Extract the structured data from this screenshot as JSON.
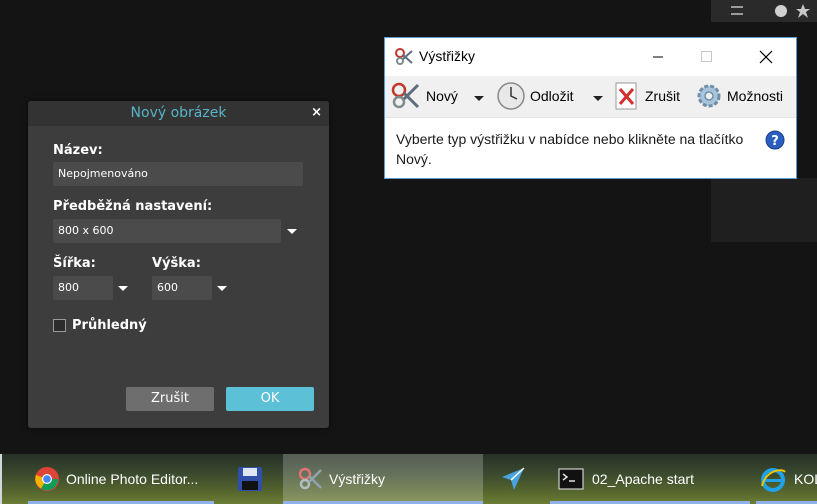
{
  "dialog": {
    "title": "Nový obrázek",
    "close_glyph": "×",
    "name_label": "Název:",
    "name_value": "Nepojmenováno",
    "preset_label": "Předběžná nastavení:",
    "preset_value": "800 x 600",
    "width_label": "Šířka:",
    "width_value": "800",
    "height_label": "Výška:",
    "height_value": "600",
    "transparent_label": "Průhledný",
    "transparent_checked": false,
    "cancel_label": "Zrušit",
    "ok_label": "OK"
  },
  "snip": {
    "title": "Výstřižky",
    "app_icon": "scissors-icon",
    "toolbar": [
      {
        "label": "Nový",
        "icon": "scissors-icon"
      },
      {
        "label": "Odložit",
        "icon": "clock-icon"
      },
      {
        "label": "Zrušit",
        "icon": "cancel-x-icon"
      },
      {
        "label": "Možnosti",
        "icon": "gear-icon"
      }
    ],
    "message": "Vyberte typ výstřižku v nabídce nebo klikněte na tlačítko Nový.",
    "help_glyph": "?"
  },
  "taskbar": {
    "items": [
      {
        "label": "Online Photo Editor...",
        "icon": "chrome-icon"
      },
      {
        "label": "",
        "icon": "floppy-disk-icon"
      },
      {
        "label": "Výstřižky",
        "icon": "scissors-icon"
      },
      {
        "label": "",
        "icon": "airplane-icon"
      },
      {
        "label": "02_Apache start",
        "icon": "terminal-icon"
      },
      {
        "label": "KOL",
        "icon": "internet-explorer-icon"
      }
    ]
  },
  "colors": {
    "dialog_title": "#58b4c8",
    "ok_button": "#5cc0d6",
    "snip_border": "#5a9bd8"
  }
}
